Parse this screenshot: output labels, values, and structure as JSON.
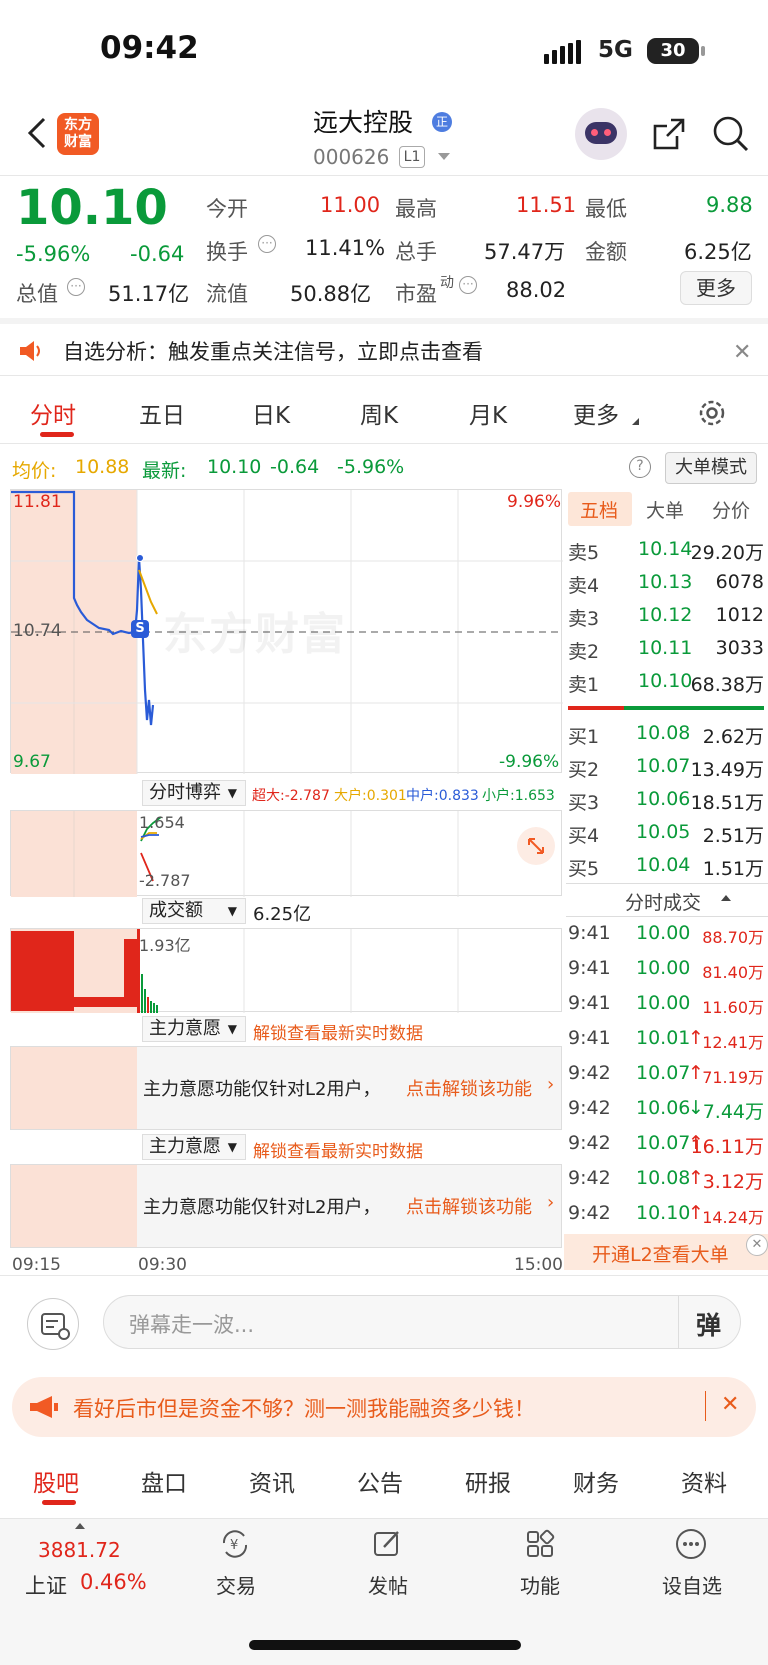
{
  "status": {
    "time": "09:42",
    "network": "5G",
    "battery": "30"
  },
  "header": {
    "logo_text": "东方财富",
    "title": "远大控股",
    "title_badge": "正",
    "code": "000626",
    "level": "L1"
  },
  "quote": {
    "price": "10.10",
    "change_pct": "-5.96%",
    "change": "-0.64",
    "open_label": "今开",
    "open": "11.00",
    "high_label": "最高",
    "high": "11.51",
    "low_label": "最低",
    "low": "9.88",
    "turnover_label": "换手",
    "turnover": "11.41%",
    "volume_label": "总手",
    "volume": "57.47万",
    "amount_label": "金额",
    "amount": "6.25亿",
    "mktcap_label": "总值",
    "mktcap": "51.17亿",
    "float_label": "流值",
    "float": "50.88亿",
    "pe_label": "市盈",
    "pe_sup": "动",
    "pe": "88.02",
    "more": "更多"
  },
  "alert": {
    "text": "自选分析：触发重点关注信号，立即点击查看"
  },
  "chart_tabs": [
    "分时",
    "五日",
    "日K",
    "周K",
    "月K",
    "更多"
  ],
  "subline": {
    "avg_label": "均价:",
    "avg": "10.88",
    "latest_label": "最新:",
    "latest": "10.10",
    "chg": "-0.64",
    "pct": "-5.96%",
    "mode_button": "大单模式"
  },
  "chart": {
    "y_max": "11.81",
    "y_mid": "10.74",
    "y_min": "9.67",
    "pct_max": "9.96%",
    "pct_min": "-9.96%",
    "watermark": "东方财富",
    "marker": "S",
    "x_start": "09:15",
    "x_mid": "09:30",
    "x_end": "15:00"
  },
  "boyi": {
    "label": "分时博弈",
    "legend": [
      {
        "text": "超大:-2.787",
        "color": "#e0261b"
      },
      {
        "text": "大户:0.301",
        "color": "#e6a800"
      },
      {
        "text": "中户:0.833",
        "color": "#2a5bd7"
      },
      {
        "text": "小户:1.653",
        "color": "#0a9a3a"
      }
    ],
    "top": "1.654",
    "bottom": "-2.787"
  },
  "amount_panel": {
    "label": "成交额",
    "value": "6.25亿",
    "axis": "1.93亿"
  },
  "intent_panels": [
    {
      "label": "主力意愿",
      "lock": "解锁查看最新实时数据",
      "msg": "主力意愿功能仅针对L2用户，",
      "link": "点击解锁该功能"
    },
    {
      "label": "主力意愿",
      "lock": "解锁查看最新实时数据",
      "msg": "主力意愿功能仅针对L2用户，",
      "link": "点击解锁该功能"
    }
  ],
  "side_tabs": [
    "五档",
    "大单",
    "分价"
  ],
  "orderbook": {
    "asks": [
      {
        "label": "卖5",
        "price": "10.14",
        "vol": "29.20万"
      },
      {
        "label": "卖4",
        "price": "10.13",
        "vol": "6078"
      },
      {
        "label": "卖3",
        "price": "10.12",
        "vol": "1012"
      },
      {
        "label": "卖2",
        "price": "10.11",
        "vol": "3033"
      },
      {
        "label": "卖1",
        "price": "10.10",
        "vol": "68.38万"
      }
    ],
    "bids": [
      {
        "label": "买1",
        "price": "10.08",
        "vol": "2.62万"
      },
      {
        "label": "买2",
        "price": "10.07",
        "vol": "13.49万"
      },
      {
        "label": "买3",
        "price": "10.06",
        "vol": "18.51万"
      },
      {
        "label": "买4",
        "price": "10.05",
        "vol": "2.51万"
      },
      {
        "label": "买5",
        "price": "10.04",
        "vol": "1.51万"
      }
    ]
  },
  "trades": {
    "title": "分时成交",
    "rows": [
      {
        "time": "9:41",
        "price": "10.00",
        "arrow": "",
        "vol": "88.70万",
        "vcolor": "#e0261b"
      },
      {
        "time": "9:41",
        "price": "10.00",
        "arrow": "",
        "vol": "81.40万",
        "vcolor": "#e0261b"
      },
      {
        "time": "9:41",
        "price": "10.00",
        "arrow": "",
        "vol": "11.60万",
        "vcolor": "#e0261b"
      },
      {
        "time": "9:41",
        "price": "10.01",
        "arrow": "↑",
        "vol": "12.41万",
        "vcolor": "#e0261b"
      },
      {
        "time": "9:42",
        "price": "10.07",
        "arrow": "↑",
        "vol": "71.19万",
        "vcolor": "#e0261b"
      },
      {
        "time": "9:42",
        "price": "10.06",
        "arrow": "↓",
        "vol": "7.44万",
        "vcolor": "#0a9a3a"
      },
      {
        "time": "9:42",
        "price": "10.07",
        "arrow": "↑",
        "vol": "16.11万",
        "vcolor": "#e0261b"
      },
      {
        "time": "9:42",
        "price": "10.08",
        "arrow": "↑",
        "vol": "3.12万",
        "vcolor": "#e0261b"
      },
      {
        "time": "9:42",
        "price": "10.10",
        "arrow": "↑",
        "vol": "14.24万",
        "vcolor": "#e0261b"
      }
    ],
    "l2_link": "开通L2查看大单"
  },
  "danmu": {
    "placeholder": "弹幕走一波...",
    "send": "弹"
  },
  "banner": {
    "text": "看好后市但是资金不够？测一测我能融资多少钱！"
  },
  "bottom_tabs": [
    "股吧",
    "盘口",
    "资讯",
    "公告",
    "研报",
    "财务",
    "资料"
  ],
  "bottom_nav": {
    "index_value": "3881.72",
    "index_name": "上证",
    "index_pct": "0.46%",
    "items": [
      {
        "label": "交易",
        "icon": "yuan-exchange-icon"
      },
      {
        "label": "发帖",
        "icon": "edit-post-icon"
      },
      {
        "label": "功能",
        "icon": "grid-apps-icon"
      },
      {
        "label": "设自选",
        "icon": "more-dots-icon"
      }
    ]
  }
}
